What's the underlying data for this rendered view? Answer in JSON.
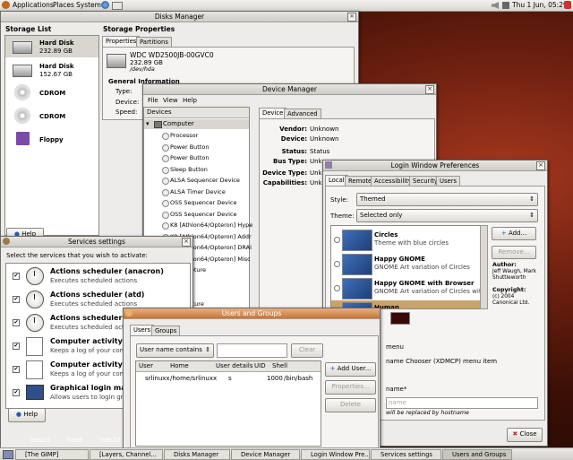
{
  "top_panel": {
    "menus": [
      "Applications",
      "Places",
      "System"
    ],
    "clock": "Thu 1 Jun, 05:29"
  },
  "disks_manager": {
    "title": "Disks Manager",
    "storage_list_label": "Storage List",
    "storage_properties_label": "Storage Properties",
    "tabs": [
      "Properties",
      "Partitions"
    ],
    "devices": [
      {
        "name": "Hard Disk",
        "size": "232.89 GB"
      },
      {
        "name": "Hard Disk",
        "size": "152.67 GB"
      },
      {
        "name": "CDROM",
        "size": ""
      },
      {
        "name": "CDROM",
        "size": ""
      },
      {
        "name": "Floppy",
        "size": ""
      }
    ],
    "disk_model": "WDC WD2500JB-00GVC0",
    "disk_size": "232.89 GB",
    "disk_path": "/dev/hda",
    "general_info": "General Information",
    "info_labels": [
      "Type:",
      "Device:",
      "Speed:"
    ],
    "help": "Help"
  },
  "device_manager": {
    "title": "Device Manager",
    "menu": [
      "File",
      "View",
      "Help"
    ],
    "devices_header": "Devices",
    "tree": [
      "Computer",
      "Processor",
      "Power Button",
      "Power Button",
      "Sleep Button",
      "ALSA Sequencer Device",
      "ALSA Timer Device",
      "OSS Sequencer Device",
      "OSS Sequencer Device",
      "K8 [Athlon64/Opteron] Hype",
      "K8 [Athlon64/Opteron] Addr",
      "K8 [Athlon64/Opteron] DRAI",
      "K8 [Athlon64/Opteron] Misc",
      "deo Capture",
      "evice",
      "evice",
      "dio Capture"
    ],
    "tabs": [
      "Device",
      "Advanced"
    ],
    "props": [
      {
        "label": "Vendor:",
        "value": "Unknown"
      },
      {
        "label": "Device:",
        "value": "Unknown"
      },
      {
        "label": "Status:",
        "value": "Status"
      },
      {
        "label": "Bus Type:",
        "value": "Unkno"
      },
      {
        "label": "Device Type:",
        "value": "Unk"
      },
      {
        "label": "Capabilities:",
        "value": "Unk"
      }
    ]
  },
  "login_prefs": {
    "title": "Login Window Preferences",
    "tabs": [
      "Local",
      "Remote",
      "Accessibility",
      "Security",
      "Users"
    ],
    "style_label": "Style:",
    "style_value": "Themed",
    "theme_label": "Theme:",
    "theme_value": "Selected only",
    "themes": [
      {
        "name": "Circles",
        "desc": "Theme with blue circles"
      },
      {
        "name": "Happy GNOME",
        "desc": "GNOME Art variation of Circles"
      },
      {
        "name": "Happy GNOME with Browser",
        "desc": "GNOME Art variation of Circles with a Face"
      },
      {
        "name": "Human",
        "desc": ""
      }
    ],
    "add_button": "Add...",
    "remove_button": "Remove...",
    "author_label": "Author:",
    "author_value": "Jeff Waugh, Mark Shuttleworth",
    "copyright_label": "Copyright:",
    "copyright_value": "(c) 2004 Canonical Ltd.",
    "partial_lines": [
      "menu",
      "name Chooser (XDMCP) menu item",
      "name*",
      "name",
      "will be replaced by hostname"
    ],
    "close_button": "Close"
  },
  "services": {
    "title": "Services settings",
    "instruction": "Select the services that you wish to activate:",
    "items": [
      {
        "name": "Actions scheduler (anacron)",
        "desc": "Executes scheduled actions",
        "checked": true
      },
      {
        "name": "Actions scheduler (atd)",
        "desc": "Executes scheduled actions",
        "checked": true
      },
      {
        "name": "Actions scheduler",
        "desc": "Executes scheduled actions",
        "checked": true
      },
      {
        "name": "Computer activity",
        "desc": "Keeps a log of your comp",
        "checked": true
      },
      {
        "name": "Computer activity",
        "desc": "Keeps a log of your comp",
        "checked": true
      },
      {
        "name": "Graphical login ma",
        "desc": "Allows users to login grap",
        "checked": true
      }
    ],
    "help": "Help"
  },
  "users_groups": {
    "title": "Users and Groups",
    "tabs": [
      "Users",
      "Groups"
    ],
    "filter_value": "User name contains",
    "clear_button": "Clear",
    "columns": [
      "User",
      "Home",
      "User details",
      "UID",
      "Shell"
    ],
    "rows": [
      {
        "user": "srlinuxx",
        "home": "/home/srlinuxx",
        "details": "s",
        "uid": "1000",
        "shell": "/bin/bash"
      }
    ],
    "add_user": "Add User...",
    "properties": "Properties...",
    "delete": "Delete"
  },
  "desktop_icons": [
    "hda23",
    "hda8",
    "hdb20"
  ],
  "taskbar": [
    "[The GIMP]",
    "[Layers, Channel...",
    "Disks Manager",
    "Device Manager",
    "Login Window Pre...",
    "Services settings",
    "Users and Groups"
  ],
  "colors": {
    "active_title": "#c77536",
    "wallpaper": "#6e2010"
  }
}
